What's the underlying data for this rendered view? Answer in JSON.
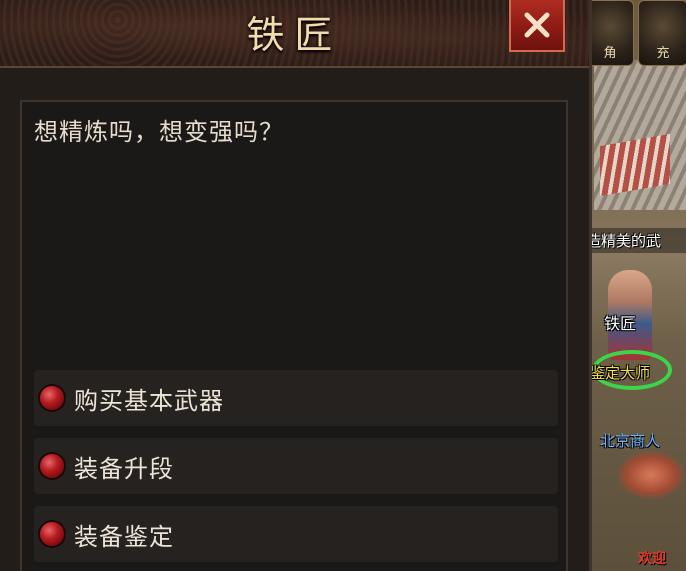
{
  "dialog": {
    "title": "铁匠",
    "close_icon": "close-icon",
    "message": "想精炼吗，想变强吗？",
    "options": [
      {
        "label": "购买基本武器",
        "icon": "red-orb-bullet"
      },
      {
        "label": "装备升段",
        "icon": "red-orb-bullet"
      },
      {
        "label": "装备鉴定",
        "icon": "red-orb-bullet"
      }
    ]
  },
  "scene": {
    "top_buttons": [
      "角",
      "充"
    ],
    "hover_text": "造精美的武",
    "npc_name": "铁匠",
    "npc_title": "鉴定大师",
    "npc2_name": "北京商人",
    "bottom_text": "欢迎"
  },
  "colors": {
    "title_gold": "#f2dcae",
    "close_red": "#b02c22",
    "bullet_red": "#b51c20",
    "panel_bg": "#1b1918",
    "option_bg": "#262220",
    "npc_ring_green": "#3ed44a",
    "npc_title_yellow": "#f4e04a"
  }
}
